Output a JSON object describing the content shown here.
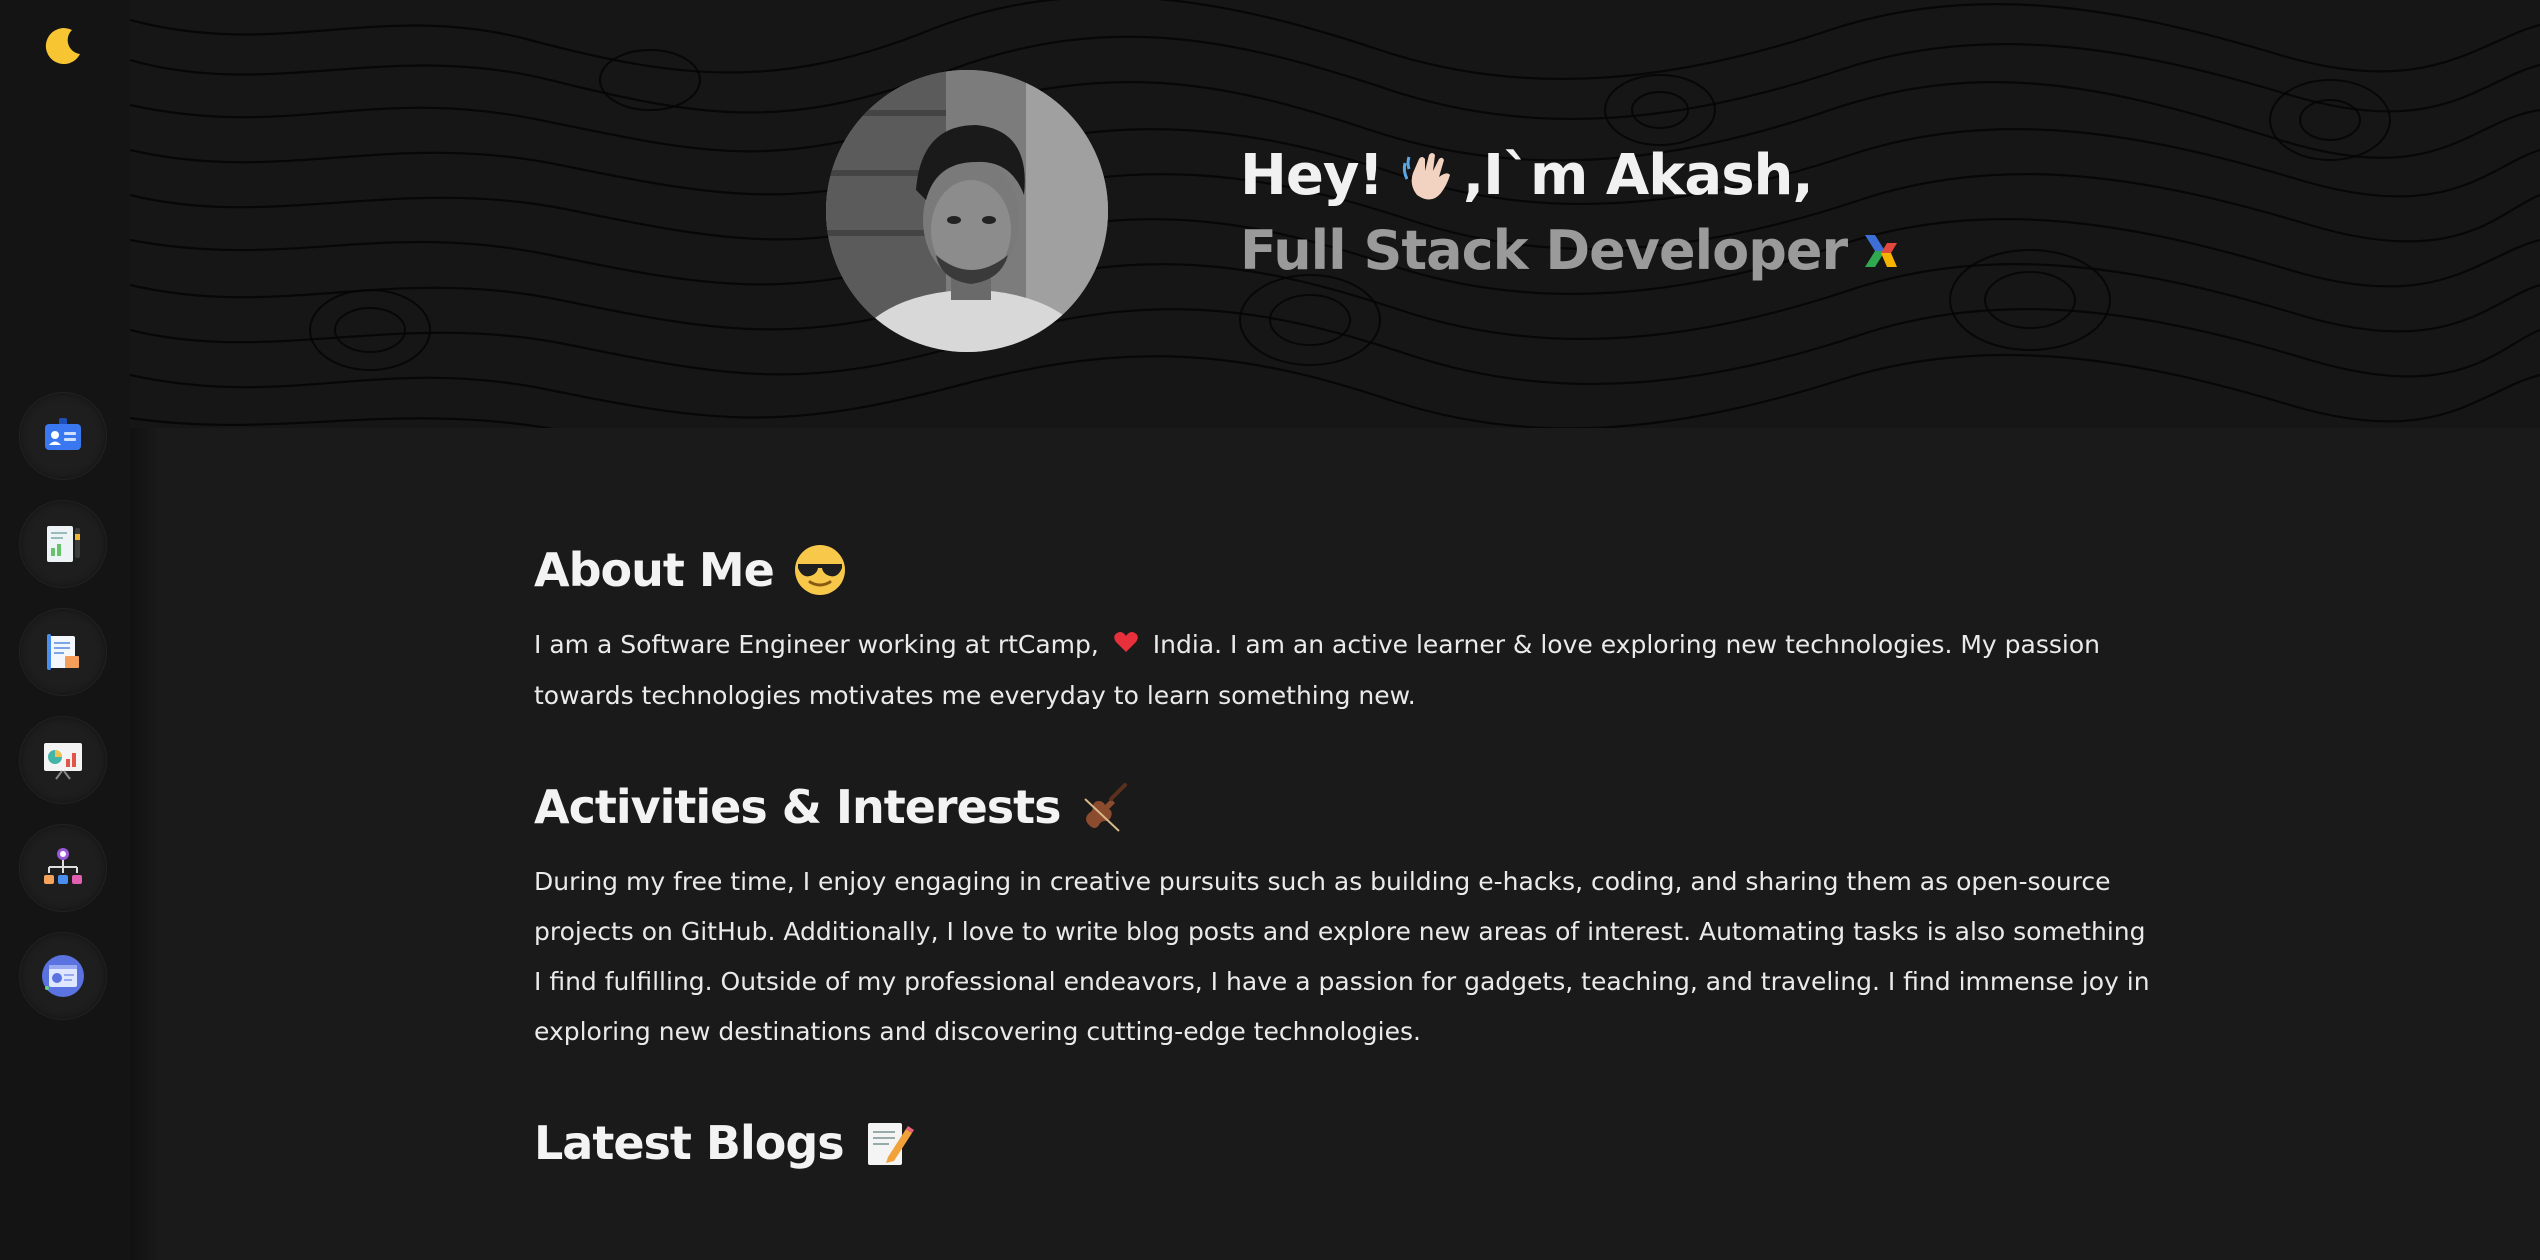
{
  "sidebar": {
    "theme_toggle_icon": "moon-icon",
    "items": [
      {
        "icon": "id-card-icon"
      },
      {
        "icon": "resume-document-icon"
      },
      {
        "icon": "blog-scroll-icon"
      },
      {
        "icon": "presentation-board-icon"
      },
      {
        "icon": "org-chart-icon"
      },
      {
        "icon": "web-browser-icon"
      }
    ]
  },
  "hero": {
    "greeting": "Hey!",
    "greeting_suffix": ",I`m Akash,",
    "role": "Full Stack Developer",
    "greeting_icon": "waving-hand-icon",
    "role_icon": "rtcamp-logo-icon"
  },
  "about": {
    "title": "About Me",
    "title_icon": "sunglasses-face-icon",
    "text_before_heart": "I am a Software Engineer working at rtCamp,",
    "text_after_heart": "India. I am an active learner & love exploring new technologies. My passion towards technologies motivates me everyday to learn something new."
  },
  "activities": {
    "title": "Activities & Interests",
    "title_icon": "violin-icon",
    "text": "During my free time, I enjoy engaging in creative pursuits such as building e-hacks, coding, and sharing them as open-source projects on GitHub. Additionally, I love to write blog posts and explore new areas of interest. Automating tasks is also something I find fulfilling. Outside of my professional endeavors, I have a passion for gadgets, teaching, and traveling. I find immense joy in exploring new destinations and discovering cutting-edge technologies."
  },
  "blogs": {
    "title": "Latest Blogs",
    "title_icon": "memo-icon"
  },
  "colors": {
    "background": "#1a1a1a",
    "sidebar": "#141414",
    "hero_bg": "#161616",
    "role_text": "#9a9a9a",
    "nav_accent": "#3a78f2"
  }
}
